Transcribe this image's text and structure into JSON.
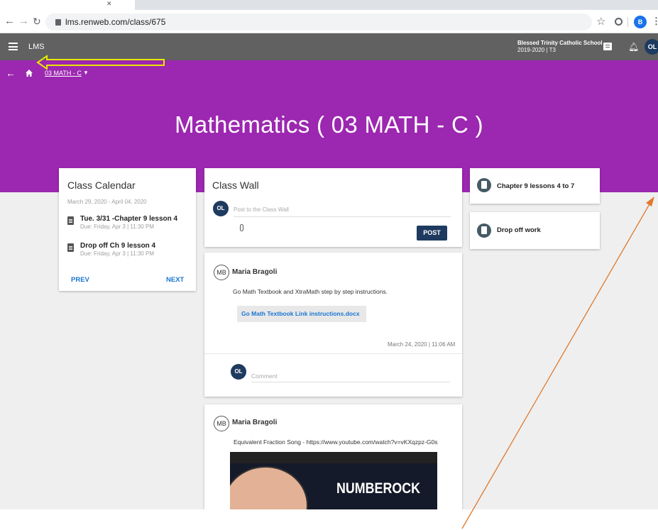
{
  "browser": {
    "url": "lms.renweb.com/class/675",
    "profile_initial": "B"
  },
  "topbar": {
    "app_title": "LMS",
    "school_name": "Blessed Trinity Catholic School",
    "school_term": "2019-2020 | T3",
    "user_initials": "OL"
  },
  "header": {
    "breadcrumb": "03 MATH - C",
    "title": "Mathematics ( 03 MATH - C )",
    "accent_color": "#9c27b0"
  },
  "calendar": {
    "title": "Class Calendar",
    "range": "March 29, 2020 - April 04, 2020",
    "items": [
      {
        "title": "Tue. 3/31 -Chapter 9 lesson 4",
        "due": "Due: Friday, Apr 3 | 11:30 PM"
      },
      {
        "title": "Drop off Ch 9 lesson 4",
        "due": "Due: Friday, Apr 3 | 11:30 PM"
      }
    ],
    "prev_label": "PREV",
    "next_label": "NEXT"
  },
  "wall": {
    "title": "Class Wall",
    "user_initials": "OL",
    "post_placeholder": "Post to the Class Wall",
    "post_label": "POST",
    "posts": [
      {
        "author_initials": "MB",
        "author": "Maria Bragoli",
        "text": "Go Math Textbook and XtraMath step by step instructions.",
        "attachment": "Go Math Textbook Link instructions.docx",
        "date": "March 24, 2020 | 11:06 AM",
        "comment_placeholder": "Comment"
      },
      {
        "author_initials": "MB",
        "author": "Maria Bragoli",
        "text": "Equivalent Fraction Song - https://www.youtube.com/watch?v=vKXqzpz-G0s",
        "video_title": "NUMBEROCK"
      }
    ]
  },
  "sidebar": {
    "items": [
      {
        "label": "Chapter 9 lessons 4 to 7"
      },
      {
        "label": "Drop off work"
      }
    ]
  }
}
